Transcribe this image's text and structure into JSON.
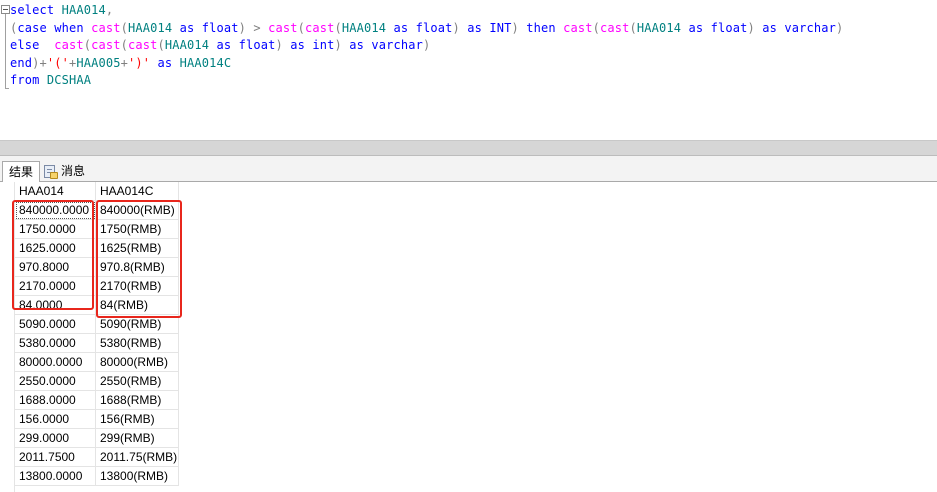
{
  "query": {
    "lines": [
      [
        {
          "t": "select ",
          "c": "kw"
        },
        {
          "t": "HAA014",
          "c": "id"
        },
        {
          "t": ",",
          "c": "op"
        }
      ],
      [
        {
          "t": "(",
          "c": "op"
        },
        {
          "t": "case when ",
          "c": "kw"
        },
        {
          "t": "cast",
          "c": "fn"
        },
        {
          "t": "(",
          "c": "op"
        },
        {
          "t": "HAA014 ",
          "c": "id"
        },
        {
          "t": "as ",
          "c": "kw"
        },
        {
          "t": "float",
          "c": "kw"
        },
        {
          "t": ") > ",
          "c": "op"
        },
        {
          "t": "cast",
          "c": "fn"
        },
        {
          "t": "(",
          "c": "op"
        },
        {
          "t": "cast",
          "c": "fn"
        },
        {
          "t": "(",
          "c": "op"
        },
        {
          "t": "HAA014 ",
          "c": "id"
        },
        {
          "t": "as ",
          "c": "kw"
        },
        {
          "t": "float",
          "c": "kw"
        },
        {
          "t": ") ",
          "c": "op"
        },
        {
          "t": "as ",
          "c": "kw"
        },
        {
          "t": "INT",
          "c": "kw"
        },
        {
          "t": ") ",
          "c": "op"
        },
        {
          "t": "then ",
          "c": "kw"
        },
        {
          "t": "cast",
          "c": "fn"
        },
        {
          "t": "(",
          "c": "op"
        },
        {
          "t": "cast",
          "c": "fn"
        },
        {
          "t": "(",
          "c": "op"
        },
        {
          "t": "HAA014 ",
          "c": "id"
        },
        {
          "t": "as ",
          "c": "kw"
        },
        {
          "t": "float",
          "c": "kw"
        },
        {
          "t": ") ",
          "c": "op"
        },
        {
          "t": "as ",
          "c": "kw"
        },
        {
          "t": "varchar",
          "c": "kw"
        },
        {
          "t": ")",
          "c": "op"
        }
      ],
      [
        {
          "t": "else  ",
          "c": "kw"
        },
        {
          "t": "cast",
          "c": "fn"
        },
        {
          "t": "(",
          "c": "op"
        },
        {
          "t": "cast",
          "c": "fn"
        },
        {
          "t": "(",
          "c": "op"
        },
        {
          "t": "cast",
          "c": "fn"
        },
        {
          "t": "(",
          "c": "op"
        },
        {
          "t": "HAA014 ",
          "c": "id"
        },
        {
          "t": "as ",
          "c": "kw"
        },
        {
          "t": "float",
          "c": "kw"
        },
        {
          "t": ") ",
          "c": "op"
        },
        {
          "t": "as ",
          "c": "kw"
        },
        {
          "t": "int",
          "c": "kw"
        },
        {
          "t": ") ",
          "c": "op"
        },
        {
          "t": "as ",
          "c": "kw"
        },
        {
          "t": "varchar",
          "c": "kw"
        },
        {
          "t": ")",
          "c": "op"
        }
      ],
      [
        {
          "t": "end",
          "c": "kw"
        },
        {
          "t": ")+",
          "c": "op"
        },
        {
          "t": "'('",
          "c": "str"
        },
        {
          "t": "+",
          "c": "op"
        },
        {
          "t": "HAA005",
          "c": "id"
        },
        {
          "t": "+",
          "c": "op"
        },
        {
          "t": "')'",
          "c": "str"
        },
        {
          "t": " as ",
          "c": "kw"
        },
        {
          "t": "HAA014C",
          "c": "id"
        }
      ],
      [
        {
          "t": "from ",
          "c": "kw"
        },
        {
          "t": "DCSHAA",
          "c": "id"
        }
      ]
    ]
  },
  "tabs": {
    "results_label": "结果",
    "messages_label": "消息"
  },
  "grid": {
    "columns": [
      "HAA014",
      "HAA014C"
    ],
    "rows": [
      [
        "840000.0000",
        "840000(RMB)"
      ],
      [
        "1750.0000",
        "1750(RMB)"
      ],
      [
        "1625.0000",
        "1625(RMB)"
      ],
      [
        "970.8000",
        "970.8(RMB)"
      ],
      [
        "2170.0000",
        "2170(RMB)"
      ],
      [
        "84.0000",
        "84(RMB)"
      ],
      [
        "5090.0000",
        "5090(RMB)"
      ],
      [
        "5380.0000",
        "5380(RMB)"
      ],
      [
        "80000.0000",
        "80000(RMB)"
      ],
      [
        "2550.0000",
        "2550(RMB)"
      ],
      [
        "1688.0000",
        "1688(RMB)"
      ],
      [
        "156.0000",
        "156(RMB)"
      ],
      [
        "299.0000",
        "299(RMB)"
      ],
      [
        "2011.7500",
        "2011.75(RMB)"
      ],
      [
        "13800.0000",
        "13800(RMB)"
      ]
    ]
  },
  "colors": {
    "highlight_box": "#e8261c"
  }
}
